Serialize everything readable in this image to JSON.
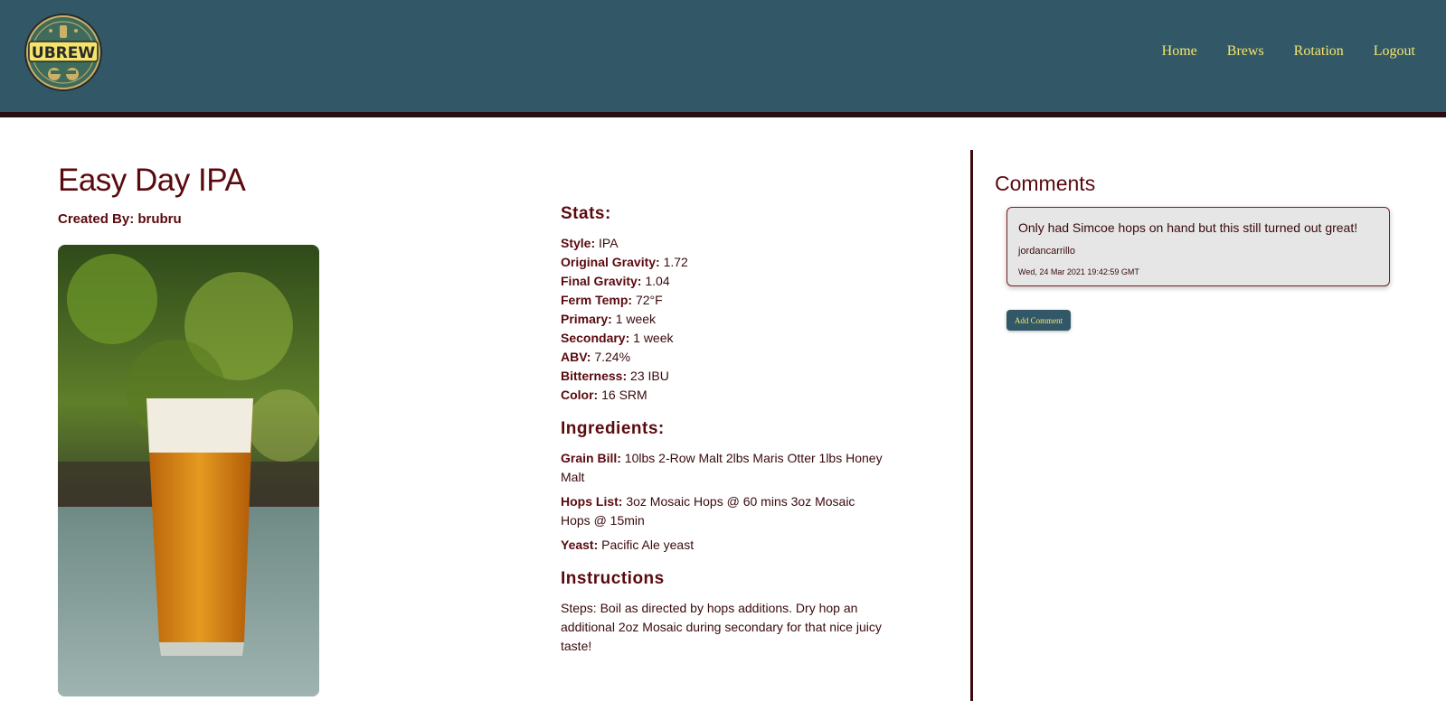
{
  "brand": {
    "logo_text": "UBREW",
    "colors": {
      "header": "#325867",
      "accent": "#f4e46b",
      "maroon": "#5a0a0f"
    }
  },
  "nav": {
    "items": [
      {
        "label": "Home"
      },
      {
        "label": "Brews"
      },
      {
        "label": "Rotation"
      },
      {
        "label": "Logout"
      }
    ]
  },
  "brew": {
    "title": "Easy Day IPA",
    "created_by": "Created By: brubru",
    "stats_heading": "Stats:",
    "stats": [
      {
        "label": "Style:",
        "value": "IPA"
      },
      {
        "label": "Original Gravity:",
        "value": "1.72"
      },
      {
        "label": "Final Gravity:",
        "value": "1.04"
      },
      {
        "label": "Ferm Temp:",
        "value": "72°F"
      },
      {
        "label": "Primary:",
        "value": "1 week"
      },
      {
        "label": "Secondary:",
        "value": "1 week"
      },
      {
        "label": "ABV:",
        "value": "7.24%"
      },
      {
        "label": "Bitterness:",
        "value": "23 IBU"
      },
      {
        "label": "Color:",
        "value": "16 SRM"
      }
    ],
    "ingredients_heading": "Ingredients:",
    "ingredients": [
      {
        "label": "Grain Bill:",
        "value": "10lbs 2-Row Malt 2lbs Maris Otter 1lbs Honey Malt"
      },
      {
        "label": "Hops List:",
        "value": "3oz Mosaic Hops @ 60 mins 3oz Mosaic Hops @ 15min"
      },
      {
        "label": "Yeast:",
        "value": "Pacific Ale yeast"
      }
    ],
    "instructions_heading": "Instructions",
    "instructions": "Steps: Boil as directed by hops additions. Dry hop an additional 2oz Mosaic during secondary for that nice juicy taste!"
  },
  "comments": {
    "heading": "Comments",
    "items": [
      {
        "text": "Only had Simcoe hops on hand but this still turned out great!",
        "user": "jordancarrillo",
        "date": "Wed, 24 Mar 2021 19:42:59 GMT"
      }
    ],
    "add_label": "Add Comment"
  }
}
